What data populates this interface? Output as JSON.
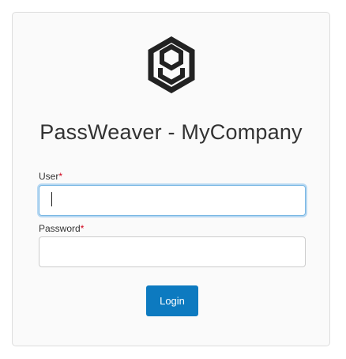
{
  "app": {
    "title": "PassWeaver - MyCompany",
    "logo_icon": "passweaver-logo-icon"
  },
  "form": {
    "user": {
      "label": "User",
      "required_mark": "*",
      "value": "",
      "placeholder": ""
    },
    "password": {
      "label": "Password",
      "required_mark": "*",
      "value": "",
      "placeholder": ""
    },
    "submit_label": "Login"
  },
  "colors": {
    "accent": "#0d7ac0",
    "required": "#d0021b",
    "focus_ring": "#66afe9"
  }
}
